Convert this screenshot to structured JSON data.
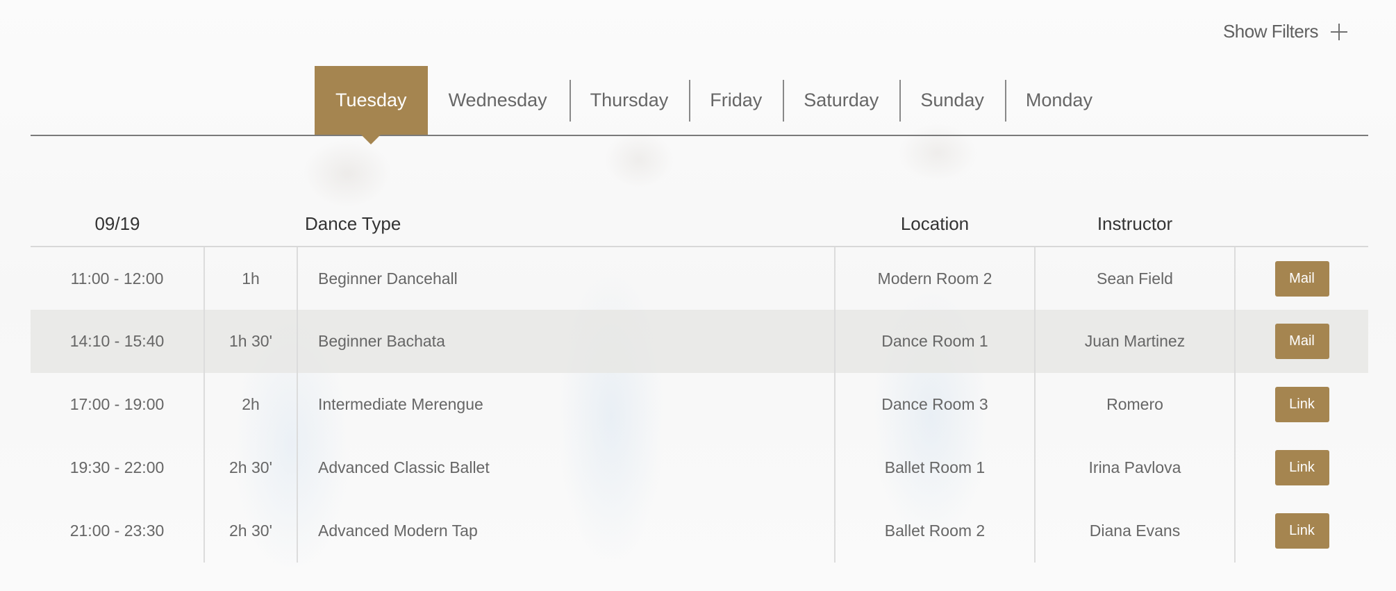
{
  "filters": {
    "label": "Show Filters",
    "icon": "plus-icon"
  },
  "tabs": [
    {
      "label": "Tuesday",
      "active": true
    },
    {
      "label": "Wednesday",
      "active": false
    },
    {
      "label": "Thursday",
      "active": false
    },
    {
      "label": "Friday",
      "active": false
    },
    {
      "label": "Saturday",
      "active": false
    },
    {
      "label": "Sunday",
      "active": false
    },
    {
      "label": "Monday",
      "active": false
    }
  ],
  "table": {
    "headers": {
      "date": "09/19",
      "duration": "",
      "type": "Dance Type",
      "location": "Location",
      "instructor": "Instructor",
      "action": ""
    },
    "rows": [
      {
        "time": "11:00 - 12:00",
        "duration": "1h",
        "type": "Beginner Dancehall",
        "location": "Modern Room 2",
        "instructor": "Sean Field",
        "action": "Mail"
      },
      {
        "time": "14:10 - 15:40",
        "duration": "1h 30'",
        "type": "Beginner Bachata",
        "location": "Dance Room 1",
        "instructor": "Juan Martinez",
        "action": "Mail"
      },
      {
        "time": "17:00 - 19:00",
        "duration": "2h",
        "type": "Intermediate Merengue",
        "location": "Dance Room 3",
        "instructor": "Romero",
        "action": "Link"
      },
      {
        "time": "19:30 - 22:00",
        "duration": "2h 30'",
        "type": "Advanced Classic Ballet",
        "location": "Ballet Room 1",
        "instructor": "Irina Pavlova",
        "action": "Link"
      },
      {
        "time": "21:00 - 23:30",
        "duration": "2h 30'",
        "type": "Advanced Modern Tap",
        "location": "Ballet Room 2",
        "instructor": "Diana Evans",
        "action": "Link"
      }
    ]
  },
  "colors": {
    "accent": "#a58550",
    "shaded_row": "#ececea",
    "divider": "#7a7a7a"
  }
}
